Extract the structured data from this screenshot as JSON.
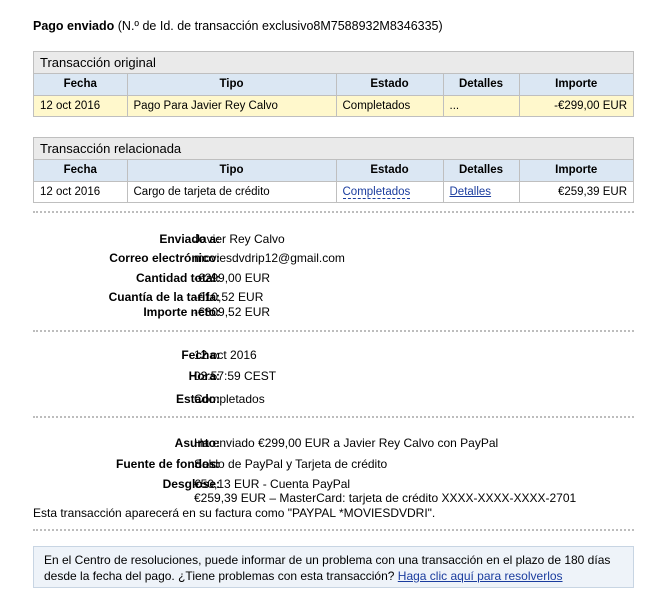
{
  "header": {
    "title_bold": "Pago enviado",
    "title_rest": "(N.º de Id. de transacción exclusivo8M7588932M8346335)"
  },
  "original": {
    "heading": "Transacción original",
    "columns": [
      "Fecha",
      "Tipo",
      "Estado",
      "Detalles",
      "Importe"
    ],
    "row": {
      "fecha": "12 oct 2016",
      "tipo": "Pago Para Javier Rey Calvo",
      "estado": "Completados",
      "detalles": "...",
      "importe": "-€299,00 EUR"
    }
  },
  "related": {
    "heading": "Transacción relacionada",
    "columns": [
      "Fecha",
      "Tipo",
      "Estado",
      "Detalles",
      "Importe"
    ],
    "row": {
      "fecha": "12 oct 2016",
      "tipo": "Cargo de tarjeta de crédito",
      "estado": "Completados",
      "detalles": "Detalles",
      "importe": "€259,39 EUR"
    }
  },
  "details": {
    "enviado_label": "Enviado a:",
    "enviado_value": "Javier Rey Calvo",
    "correo_label": "Correo electrónico:",
    "correo_value": "moviesdvdrip12@gmail.com",
    "cantidad_label": "Cantidad total:",
    "cantidad_value": "-€299,00 EUR",
    "tarifa_label": "Cuantía de la tarifa:",
    "tarifa_value": "-€10,52 EUR",
    "neto_label": "Importe neto:",
    "neto_value": "-€309,52 EUR",
    "fecha_label": "Fecha:",
    "fecha_value": "12 oct 2016",
    "hora_label": "Hora:",
    "hora_value": "03:57:59 CEST",
    "estado_label": "Estado:",
    "estado_value": "Completados",
    "asunto_label": "Asunto:",
    "asunto_value": "Ha enviado €299,00 EUR a Javier Rey Calvo con PayPal",
    "fuente_label": "Fuente de fondos:",
    "fuente_value": "Saldo de PayPal y Tarjeta de crédito",
    "desglose_label": "Desglose:",
    "desglose_line1": "€50,13 EUR - Cuenta PayPal",
    "desglose_line2": "€259,39 EUR – MasterCard: tarjeta de crédito XXXX-XXXX-XXXX-2701",
    "note": "Esta transacción aparecerá en su factura como \"PAYPAL *MOVIESDVDRI\"."
  },
  "info": {
    "text_line1": "En el Centro de resoluciones, puede informar de un problema con una transacción en el plazo de 180 días",
    "text_line2": "desde la fecha del pago. ¿Tiene problemas con esta transacción?",
    "link": "Haga clic aquí para resolverlos"
  }
}
